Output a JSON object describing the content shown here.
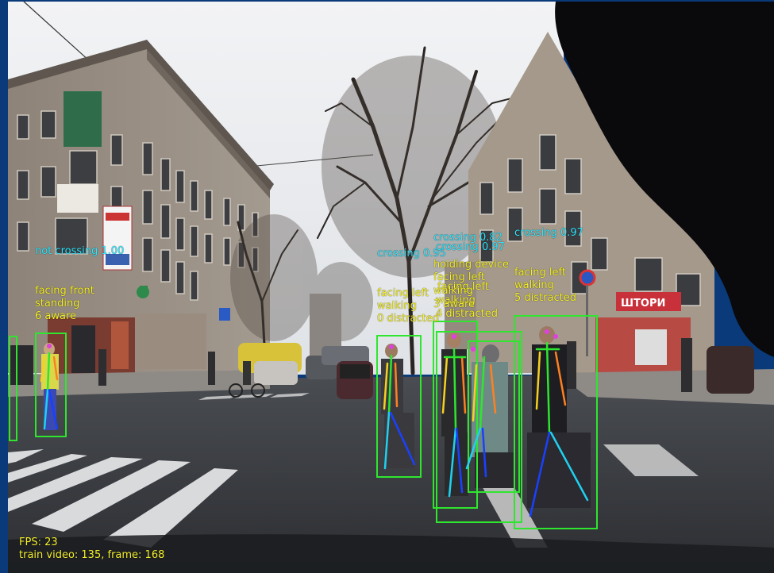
{
  "frame_info": {
    "fps": "FPS: 23",
    "source": "train video: 135, frame: 168"
  },
  "detections": [
    {
      "crossing": "not crossing 1.00",
      "orientation": "facing front",
      "motion": "standing",
      "attention": "6 aware"
    },
    {
      "crossing": "crossing 0.95",
      "orientation": "facing left",
      "motion": "walking",
      "attention": "0 distracted"
    },
    {
      "crossing": "crossing 0.82",
      "crossing_2": "crossing 0.97",
      "device": "holding device",
      "orientation": "facing left",
      "orientation_2": "facing left",
      "motion": "walking",
      "motion_2": "walking",
      "attention": "3 aware",
      "attention_2": "4 distracted"
    },
    {
      "crossing": "crossing 0.97",
      "orientation": "facing left",
      "motion": "walking",
      "attention": "5 distracted"
    }
  ],
  "colors": {
    "bounding_box": "#2fe62f",
    "crossing_label": "#2ee6ff",
    "attribute_label": "#f5f02a",
    "hud_text": "#f5f02a",
    "skeleton_limbs": [
      "#2ee62f",
      "#f5d020",
      "#20d0f0",
      "#1a40ff",
      "#ff8020"
    ],
    "keypoints": "#e040e0"
  }
}
